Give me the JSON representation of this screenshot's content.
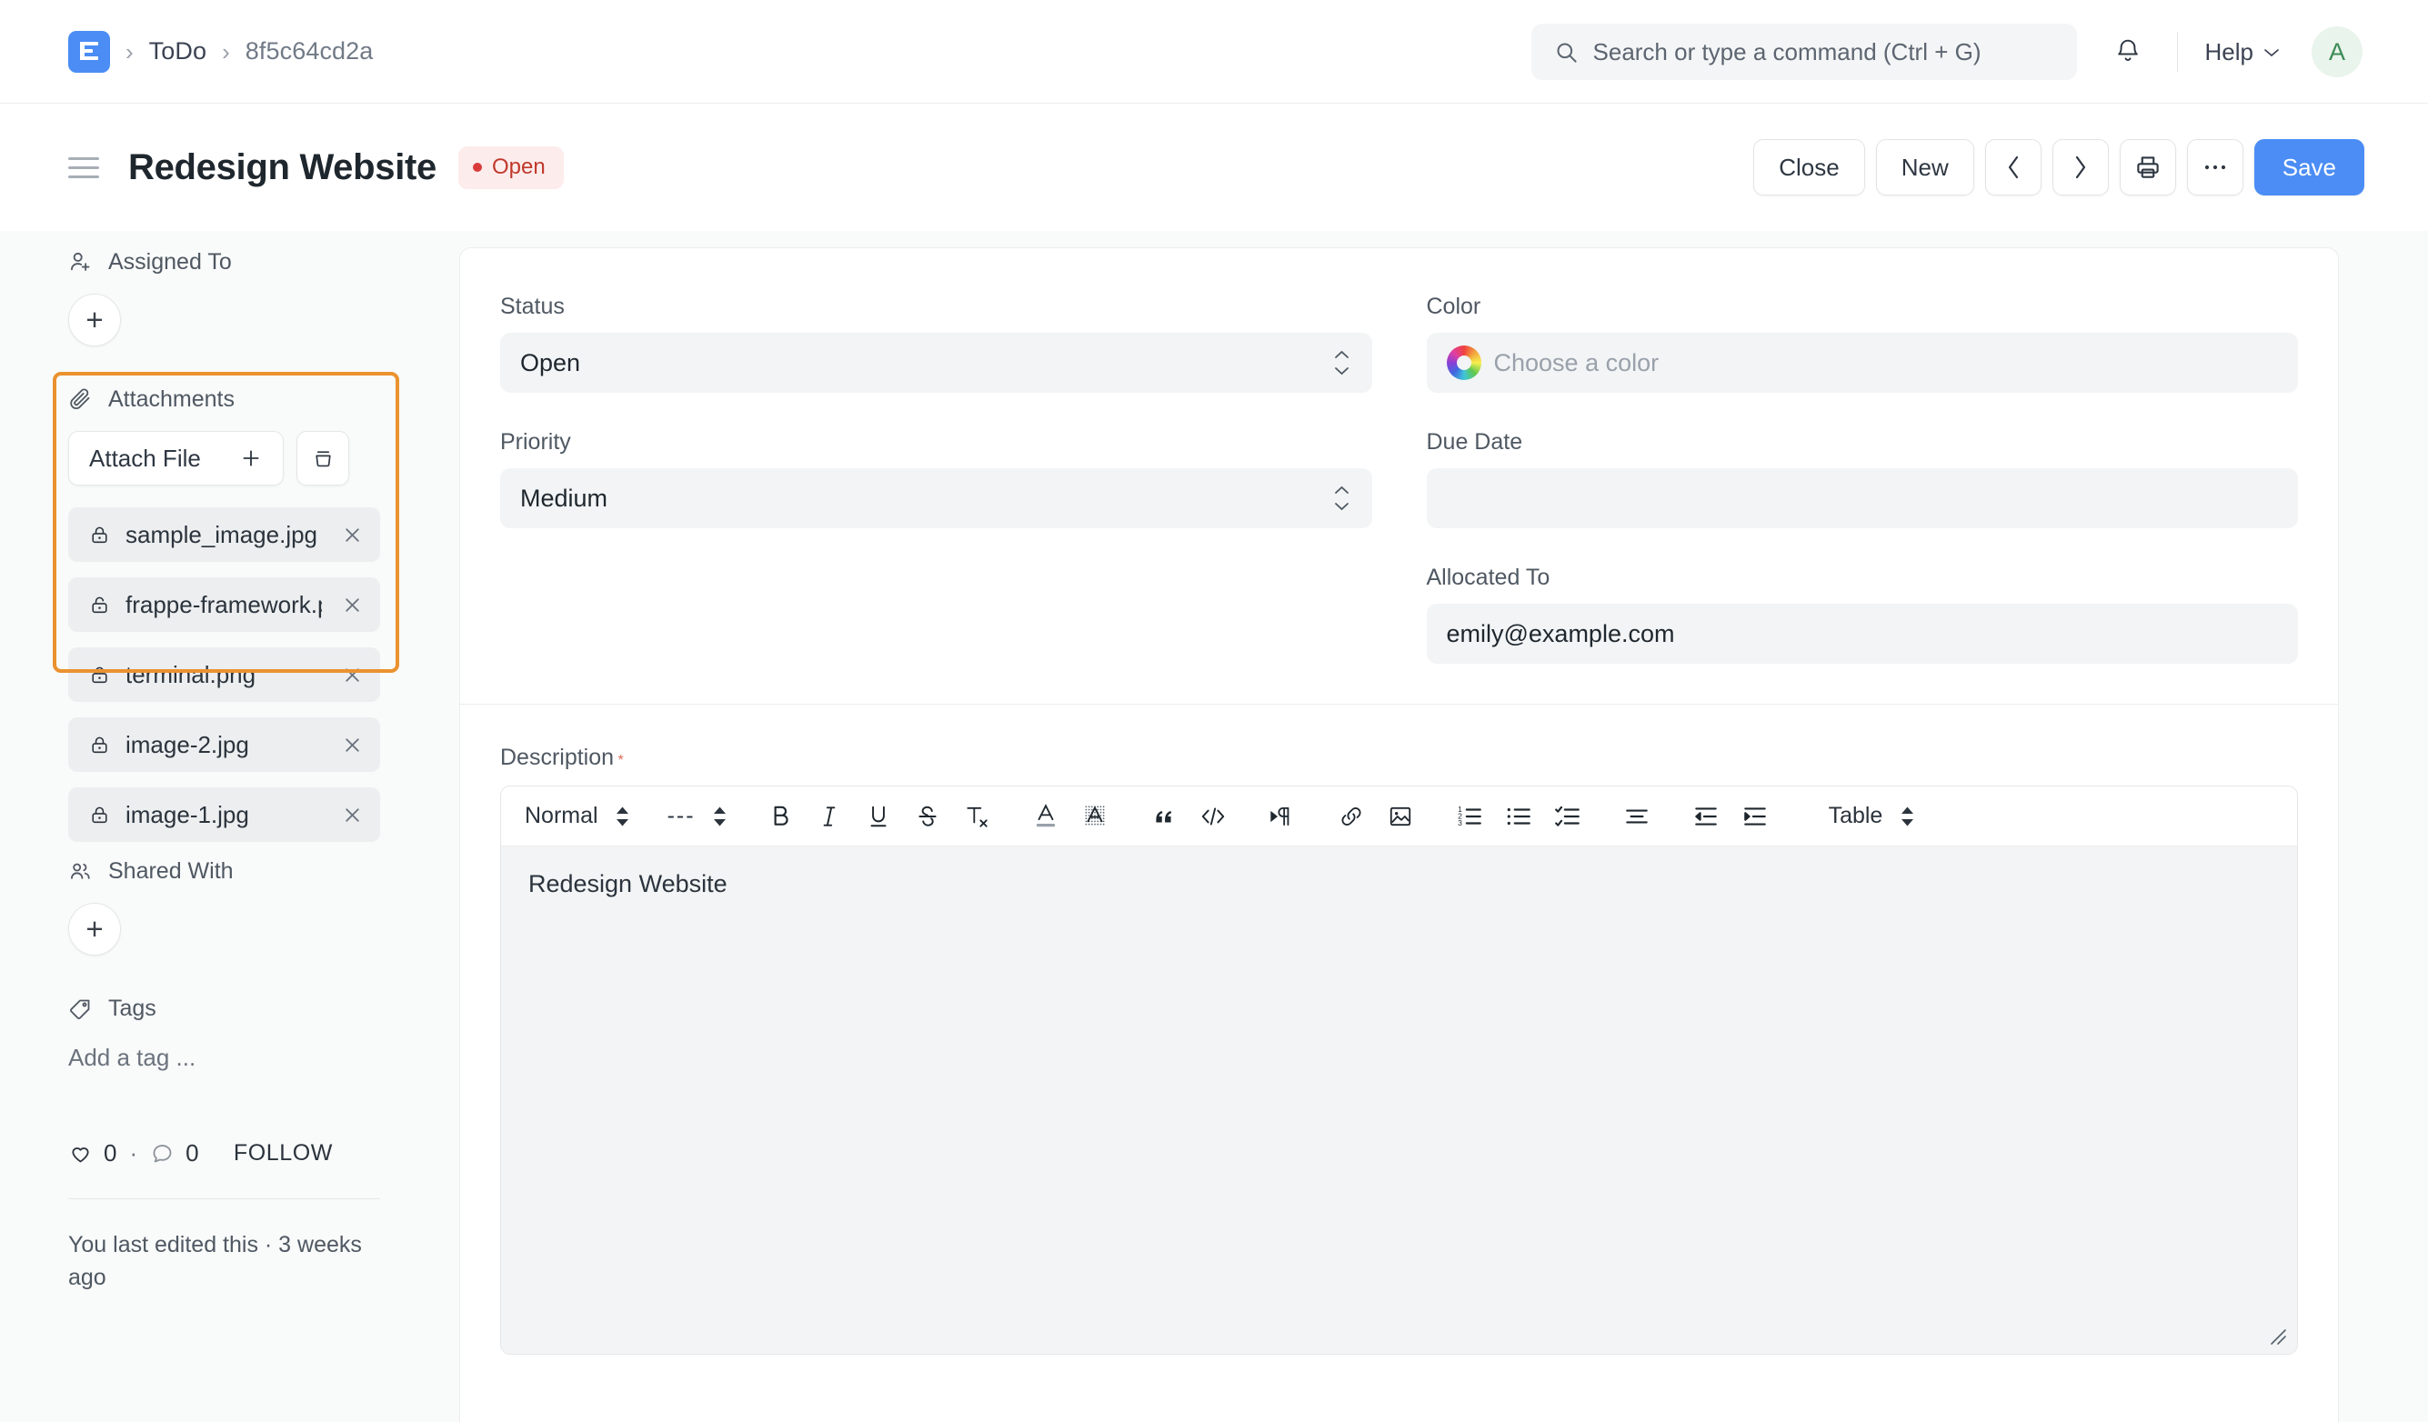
{
  "navbar": {
    "logo_letter": "E",
    "breadcrumb": [
      {
        "label": "ToDo"
      },
      {
        "label": "8f5c64cd2a"
      }
    ],
    "search": {
      "placeholder": "Search or type a command (Ctrl + G)"
    },
    "help_label": "Help",
    "avatar_initial": "A",
    "icons": {
      "search": "search-icon",
      "bell": "notification-bell-icon",
      "chevron": "chevron-down-icon"
    }
  },
  "pagehead": {
    "title": "Redesign Website",
    "status": "Open",
    "status_color": "#c0392b",
    "status_bg": "#fdecec",
    "actions": {
      "close": "Close",
      "new": "New",
      "prev": "‹",
      "next": "›",
      "print": "print-icon",
      "more": "•••",
      "save": "Save"
    },
    "accent_color": "#4b8df5"
  },
  "sidebar": {
    "assigned_to": {
      "label": "Assigned To",
      "add_label": "+"
    },
    "attachments": {
      "label": "Attachments",
      "attach_button": "Attach File",
      "attach_plus": "+",
      "highlighted": true,
      "highlight_color": "#eb9230",
      "files": [
        {
          "name": "sample_image.jpg",
          "lock": "locked",
          "remove": "×"
        },
        {
          "name": "frappe-framework.png",
          "lock": "unlocked",
          "remove": "×"
        },
        {
          "name": "terminal.png",
          "lock": "unlocked",
          "remove": "×"
        },
        {
          "name": "image-2.jpg",
          "lock": "locked",
          "remove": "×"
        },
        {
          "name": "image-1.jpg",
          "lock": "locked",
          "remove": "×"
        }
      ]
    },
    "shared_with": {
      "label": "Shared With",
      "add_label": "+"
    },
    "tags": {
      "label": "Tags",
      "placeholder": "Add a tag ..."
    },
    "stats": {
      "likes": "0",
      "separator": "·",
      "comments": "0",
      "follow": "FOLLOW"
    },
    "footer": "You last edited this · 3 weeks ago"
  },
  "form": {
    "status": {
      "label": "Status",
      "value": "Open"
    },
    "priority": {
      "label": "Priority",
      "value": "Medium"
    },
    "color": {
      "label": "Color",
      "placeholder": "Choose a color",
      "value": ""
    },
    "due_date": {
      "label": "Due Date",
      "value": ""
    },
    "allocated_to": {
      "label": "Allocated To",
      "value": "emily@example.com"
    }
  },
  "description": {
    "label": "Description",
    "required_mark": "*",
    "toolbar": {
      "paragraph_style": "Normal",
      "font_style": "---",
      "table": "Table",
      "buttons": [
        "bold-icon",
        "italic-icon",
        "underline-icon",
        "strikethrough-icon",
        "clear-format-icon",
        "font-color-icon",
        "highlight-color-icon",
        "blockquote-icon",
        "code-block-icon",
        "text-direction-icon",
        "link-icon",
        "image-icon",
        "ordered-list-icon",
        "bullet-list-icon",
        "checklist-icon",
        "align-icon",
        "outdent-icon",
        "indent-icon"
      ]
    },
    "content": "Redesign Website"
  }
}
